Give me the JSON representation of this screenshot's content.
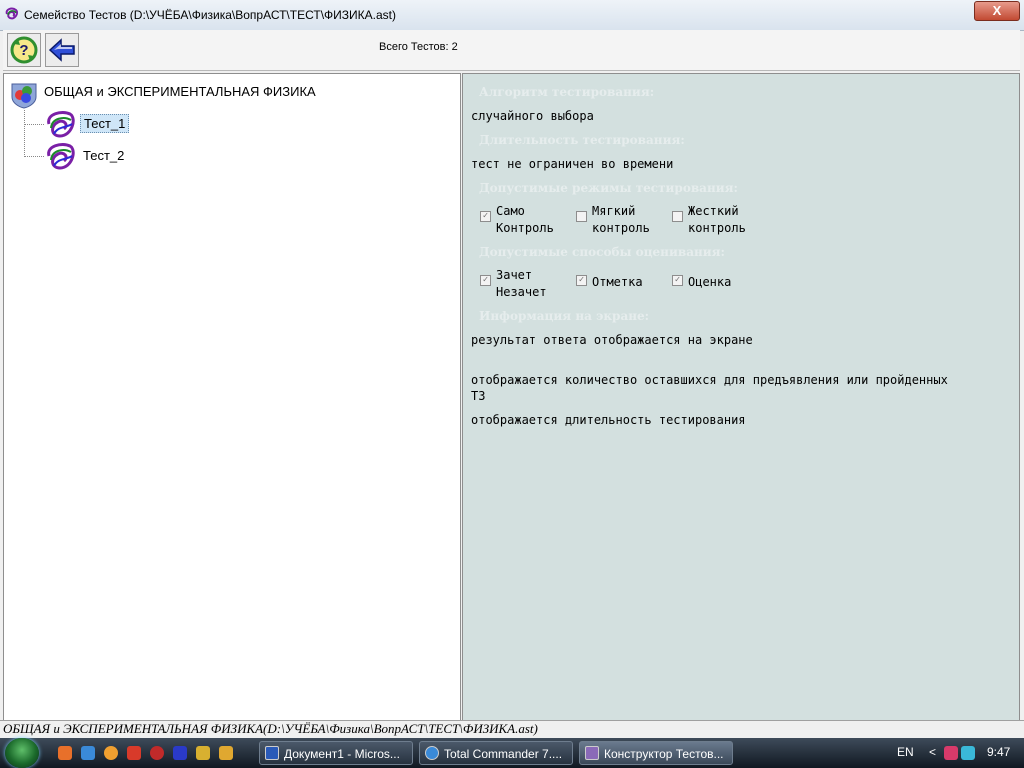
{
  "window": {
    "title": "Семейство Тестов (D:\\УЧЁБА\\Физика\\ВопрАСТ\\ТЕСТ\\ФИЗИКА.ast)",
    "close_label": "X"
  },
  "toolbar": {
    "total_tests_label": "Всего Тестов: 2",
    "buttons": [
      {
        "icon": "help-refresh-icon"
      },
      {
        "icon": "back-arrow-icon"
      }
    ]
  },
  "tree": {
    "root_label": "ОБЩАЯ и ЭКСПЕРИМЕНТАЛЬНАЯ ФИЗИКА",
    "items": [
      {
        "label": "Тест_1",
        "selected": true
      },
      {
        "label": "Тест_2",
        "selected": false
      }
    ]
  },
  "details": {
    "algorithm_heading": "Алгоритм тестирования:",
    "algorithm_value": "случайного выбора",
    "duration_heading": "Длительность тестирования:",
    "duration_value": "тест не ограничен во времени",
    "modes_heading": "Допустимые режимы тестирования:",
    "modes": [
      {
        "line1": "Само",
        "line2": "Контроль",
        "checked": true
      },
      {
        "line1": "Мягкий",
        "line2": "контроль",
        "checked": false
      },
      {
        "line1": "Жесткий",
        "line2": "контроль",
        "checked": false
      }
    ],
    "grading_heading": "Допустимые способы оценивания:",
    "grading": [
      {
        "line1": "Зачет",
        "line2": "Незачет",
        "checked": true
      },
      {
        "line1": "Отметка",
        "line2": "",
        "checked": true
      },
      {
        "line1": "Оценка",
        "line2": "",
        "checked": true
      }
    ],
    "screen_info_heading": "Информация на экране:",
    "screen_info": [
      "результат ответа отображается на экране",
      "отображается количество оставшихся для предъявления или пройденных",
      "ТЗ",
      "отображается длительность тестирования"
    ]
  },
  "statusbar": {
    "text": "ОБЩАЯ и ЭКСПЕРИМЕНТАЛЬНАЯ ФИЗИКА(D:\\УЧЁБА\\Физика\\ВопрАСТ\\ТЕСТ\\ФИЗИКА.ast)"
  },
  "taskbar": {
    "tasks": [
      {
        "label": "Документ1 - Micros...",
        "icon": "word-icon"
      },
      {
        "label": "Total Commander 7....",
        "icon": "total-commander-icon"
      },
      {
        "label": "Конструктор Тестов...",
        "icon": "constructor-app-icon"
      }
    ],
    "language": "EN",
    "tray_arrow": "<",
    "clock": "9:47",
    "colors": {
      "accent": "#2a4a7a",
      "right_panel_bg": "#d3e0df"
    }
  }
}
